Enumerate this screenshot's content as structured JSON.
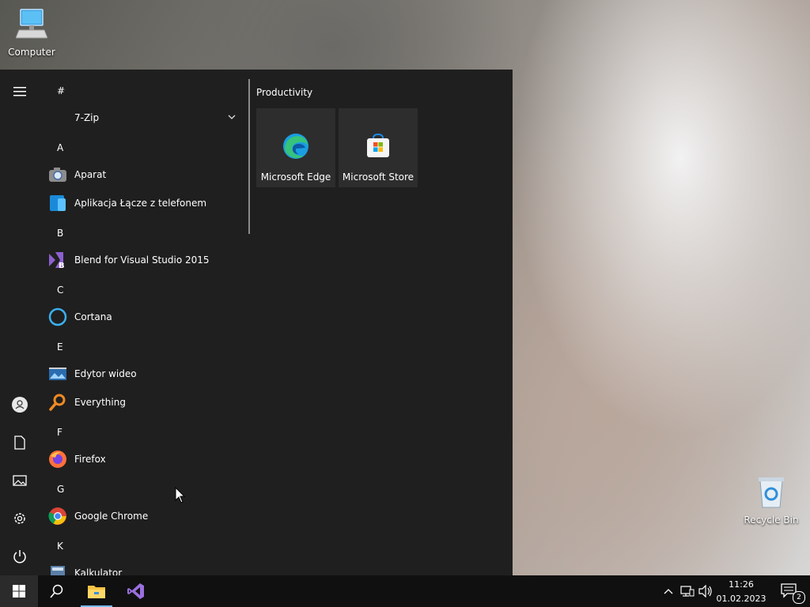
{
  "desktop": {
    "icons": [
      {
        "label": "Computer",
        "icon": "computer-icon"
      },
      {
        "label": "Recycle Bin",
        "icon": "recycle-bin-icon"
      }
    ]
  },
  "start_menu": {
    "rail": [
      {
        "name": "hamburger-icon"
      },
      {
        "name": "user-icon"
      },
      {
        "name": "documents-icon"
      },
      {
        "name": "pictures-icon"
      },
      {
        "name": "settings-icon"
      },
      {
        "name": "power-icon"
      }
    ],
    "apps": [
      {
        "type": "letter",
        "text": "#"
      },
      {
        "type": "app",
        "label": "7-Zip",
        "icon": "folder-icon",
        "expandable": true
      },
      {
        "type": "letter",
        "text": "A"
      },
      {
        "type": "app",
        "label": "Aparat",
        "icon": "camera-icon"
      },
      {
        "type": "app",
        "label": "Aplikacja Łącze z telefonem",
        "icon": "phone-link-icon"
      },
      {
        "type": "letter",
        "text": "B"
      },
      {
        "type": "app",
        "label": "Blend for Visual Studio 2015",
        "icon": "blend-icon"
      },
      {
        "type": "letter",
        "text": "C"
      },
      {
        "type": "app",
        "label": "Cortana",
        "icon": "cortana-icon"
      },
      {
        "type": "letter",
        "text": "E"
      },
      {
        "type": "app",
        "label": "Edytor wideo",
        "icon": "video-editor-icon"
      },
      {
        "type": "app",
        "label": "Everything",
        "icon": "everything-icon"
      },
      {
        "type": "letter",
        "text": "F"
      },
      {
        "type": "app",
        "label": "Firefox",
        "icon": "firefox-icon"
      },
      {
        "type": "letter",
        "text": "G"
      },
      {
        "type": "app",
        "label": "Google Chrome",
        "icon": "chrome-icon"
      },
      {
        "type": "letter",
        "text": "K"
      },
      {
        "type": "app",
        "label": "Kalkulator",
        "icon": "calculator-icon"
      }
    ],
    "tile_group": {
      "title": "Productivity",
      "tiles": [
        {
          "label": "Microsoft Edge",
          "icon": "edge-icon"
        },
        {
          "label": "Microsoft Store",
          "icon": "store-icon"
        }
      ]
    }
  },
  "taskbar": {
    "clock": {
      "time": "11:26",
      "date": "01.02.2023"
    },
    "notification_count": "2",
    "pinned": [
      "start-icon",
      "search-icon",
      "file-explorer-icon",
      "visual-studio-icon"
    ]
  }
}
